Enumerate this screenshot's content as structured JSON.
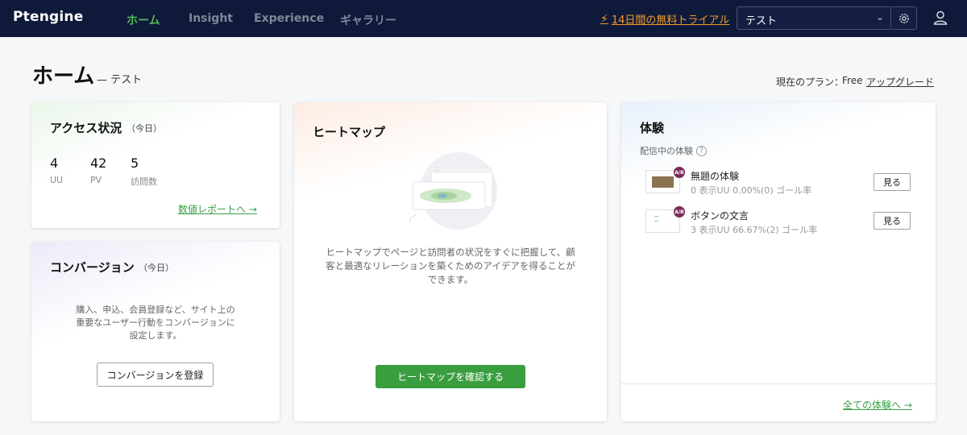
{
  "topbar": {
    "logo": "Ptengine",
    "nav": [
      {
        "label": "ホーム"
      },
      {
        "label": "Insight"
      },
      {
        "label": "Experience"
      },
      {
        "label": "ギャラリー"
      }
    ],
    "trial_label": "14日間の無料トライアル",
    "project_value": "テスト",
    "accent_color": "#53b85a",
    "trial_color": "#f39a2b"
  },
  "header": {
    "title": "ホーム",
    "subtitle": "— テスト",
    "plan_label": "現在のプラン：",
    "plan_value": "Free",
    "upgrade_label": "アップグレード"
  },
  "access": {
    "title": "アクセス状況",
    "title_sub": "（今日）",
    "metrics": [
      {
        "value": "4",
        "label": "UU"
      },
      {
        "value": "42",
        "label": "PV"
      },
      {
        "value": "5",
        "label": "訪問数"
      }
    ],
    "link": "数値レポートへ →"
  },
  "conversion": {
    "title": "コンバージョン",
    "title_sub": "（今日）",
    "desc_lines": [
      "購入、申込、会員登録など、サイト上の",
      "重要なユーザー行動をコンバージョンに",
      "設定します。"
    ],
    "button": "コンバージョンを登録"
  },
  "heatmap": {
    "title": "ヒートマップ",
    "desc_lines": [
      "ヒートマップでページと訪問者の状況をすぐに把握して、顧",
      "客と最適なリレーションを築くためのアイデアを得ることが",
      "できます。"
    ],
    "button": "ヒートマップを確認する"
  },
  "experience": {
    "title": "体験",
    "delivering_label": "配信中の体験",
    "items": [
      {
        "badge": "A/B",
        "name": "無題の体験",
        "stats": "0 表示UU   0.00%(0) ゴール率",
        "button": "見る"
      },
      {
        "badge": "A/B",
        "name": "ボタンの文言",
        "stats": "3 表示UU   66.67%(2) ゴール率",
        "button": "見る"
      }
    ],
    "all_link": "全ての体験へ →"
  }
}
